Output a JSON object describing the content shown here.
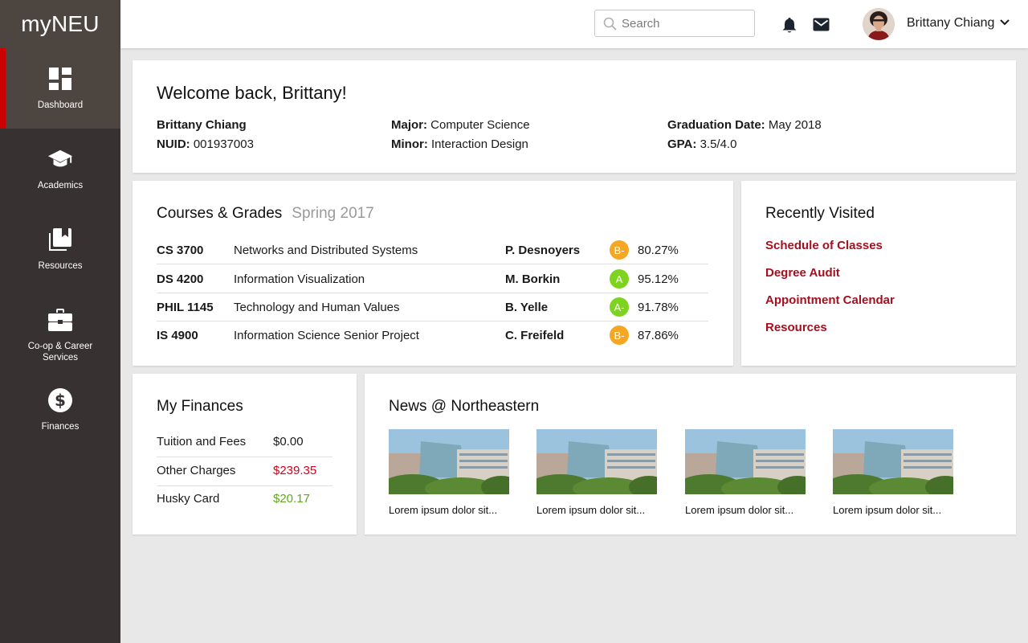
{
  "app": {
    "logo": "myNEU"
  },
  "sidebar": {
    "items": [
      {
        "label": "Dashboard",
        "icon": "dashboard-icon"
      },
      {
        "label": "Academics",
        "icon": "graduation-cap-icon"
      },
      {
        "label": "Resources",
        "icon": "bookmark-book-icon"
      },
      {
        "label": "Co-op & Career Services",
        "icon": "briefcase-icon"
      },
      {
        "label": "Finances",
        "icon": "dollar-icon"
      }
    ],
    "active_index": 0
  },
  "header": {
    "search_placeholder": "Search",
    "user_name": "Brittany Chiang"
  },
  "welcome": {
    "greeting": "Welcome back, Brittany!",
    "name": "Brittany Chiang",
    "nuid_label": "NUID:",
    "nuid": "001937003",
    "major_label": "Major:",
    "major": "Computer Science",
    "minor_label": "Minor:",
    "minor": "Interaction Design",
    "grad_label": "Graduation Date:",
    "grad": "May 2018",
    "gpa_label": "GPA:",
    "gpa": "3.5/4.0"
  },
  "courses": {
    "title": "Courses & Grades",
    "term": "Spring 2017",
    "rows": [
      {
        "code": "CS 3700",
        "name": "Networks and Distributed Systems",
        "prof": "P. Desnoyers",
        "grade": "B-",
        "pct": "80.27%",
        "color": "#f5a623"
      },
      {
        "code": "DS 4200",
        "name": "Information Visualization",
        "prof": "M. Borkin",
        "grade": "A",
        "pct": "95.12%",
        "color": "#7ed321"
      },
      {
        "code": "PHIL 1145",
        "name": "Technology and Human Values",
        "prof": "B. Yelle",
        "grade": "A-",
        "pct": "91.78%",
        "color": "#7ed321"
      },
      {
        "code": "IS 4900",
        "name": "Information Science Senior Project",
        "prof": "C. Freifeld",
        "grade": "B-",
        "pct": "87.86%",
        "color": "#f5a623"
      }
    ]
  },
  "recent": {
    "title": "Recently Visited",
    "links": [
      "Schedule of Classes",
      "Degree Audit",
      "Appointment Calendar",
      "Resources"
    ]
  },
  "finances": {
    "title": "My Finances",
    "rows": [
      {
        "label": "Tuition and Fees",
        "value": "$0.00",
        "color": "#1a1a1a"
      },
      {
        "label": "Other Charges",
        "value": "$239.35",
        "color": "#d0021b"
      },
      {
        "label": "Husky Card",
        "value": "$20.17",
        "color": "#5ea918"
      }
    ]
  },
  "news": {
    "title": "News @ Northeastern",
    "items": [
      {
        "caption": "Lorem ipsum dolor sit..."
      },
      {
        "caption": "Lorem ipsum dolor sit..."
      },
      {
        "caption": "Lorem ipsum dolor sit..."
      },
      {
        "caption": "Lorem ipsum dolor sit..."
      }
    ]
  },
  "colors": {
    "accent": "#cc0000",
    "link": "#a50f1f",
    "sidebar": "#383131"
  }
}
